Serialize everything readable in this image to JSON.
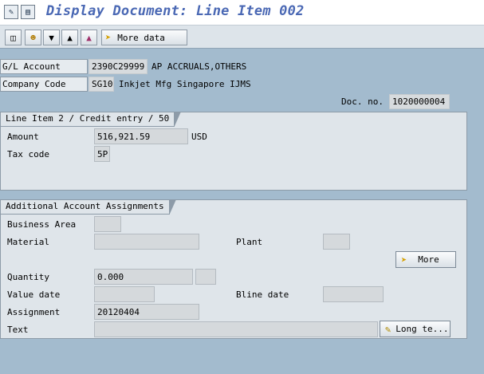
{
  "window": {
    "title": "Display Document: Line Item 002"
  },
  "toolbar": {
    "more_data_label": "More data"
  },
  "header": {
    "gl_account_label": "G/L Account",
    "gl_account_value": "2390C29999",
    "gl_account_text": "AP ACCRUALS,OTHERS",
    "company_code_label": "Company Code",
    "company_code_value": "SG10",
    "company_code_text": "Inkjet Mfg Singapore IJMS",
    "doc_no_label": "Doc. no.",
    "doc_no_value": "1020000004"
  },
  "line_item": {
    "title": "Line Item 2 / Credit entry / 50",
    "amount_label": "Amount",
    "amount_value": "516,921.59",
    "currency": "USD",
    "tax_code_label": "Tax code",
    "tax_code_value": "5P"
  },
  "additional": {
    "title": "Additional Account Assignments",
    "business_area_label": "Business Area",
    "business_area_value": "",
    "material_label": "Material",
    "material_value": "",
    "plant_label": "Plant",
    "plant_value": "",
    "more_label": "More",
    "quantity_label": "Quantity",
    "quantity_value": "0.000",
    "quantity_unit": "",
    "value_date_label": "Value date",
    "value_date_value": "",
    "bline_date_label": "Bline date",
    "bline_date_value": "",
    "assignment_label": "Assignment",
    "assignment_value": "20120404",
    "text_label": "Text",
    "text_value": "",
    "long_text_label": "Long te..."
  },
  "icons": [
    "display-change-icon",
    "document-icon",
    "overview-icon",
    "user-icon",
    "down-arrow-icon",
    "up-arrow-icon",
    "hat-icon",
    "more-data-arrow-icon",
    "more-arrow-icon",
    "long-text-icon"
  ],
  "colors": {
    "background": "#a3bbce",
    "title": "#4a68b4",
    "group": "#dfe5ea",
    "field": "#d5d9dc"
  }
}
